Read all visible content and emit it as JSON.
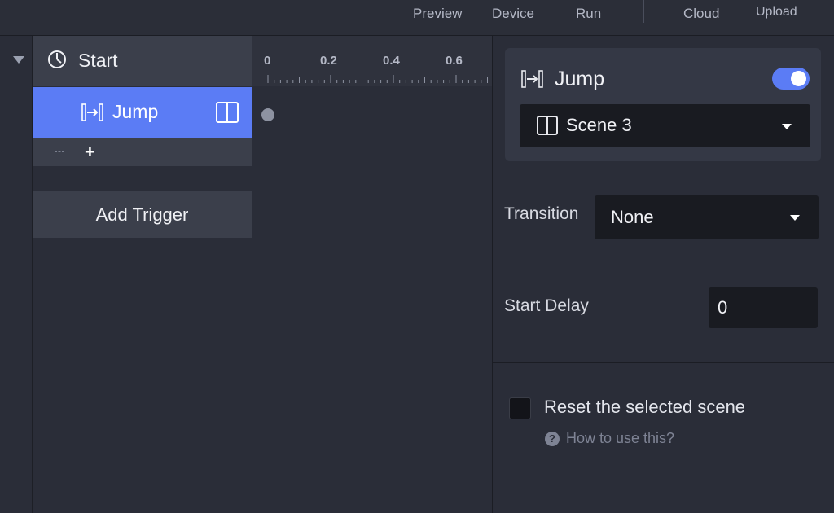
{
  "toolbar": {
    "preview": "Preview",
    "device": "Device",
    "run": "Run",
    "cloud": "Cloud",
    "upload": "Upload"
  },
  "tree": {
    "start_label": "Start",
    "jump_label": "Jump",
    "add_symbol": "+",
    "add_trigger": "Add Trigger"
  },
  "timeline": {
    "ticks": [
      "0",
      "0.2",
      "0.4",
      "0.6"
    ]
  },
  "inspector": {
    "action_title": "Jump",
    "enabled": true,
    "target_scene": "Scene 3",
    "transition_label": "Transition",
    "transition_value": "None",
    "start_delay_label": "Start Delay",
    "start_delay_value": "0",
    "reset_label": "Reset the selected scene",
    "reset_checked": false,
    "help_symbol": "?",
    "help_link": "How to use this?"
  },
  "colors": {
    "accent": "#5b7cf5",
    "background": "#2a2d38",
    "panel": "#3b3f4b",
    "field": "#191b21"
  },
  "icons": {
    "start": "timer-icon",
    "jump": "jump-action-icon",
    "scene": "scene-icon",
    "dropdown": "caret-down-icon",
    "help": "help-icon"
  }
}
